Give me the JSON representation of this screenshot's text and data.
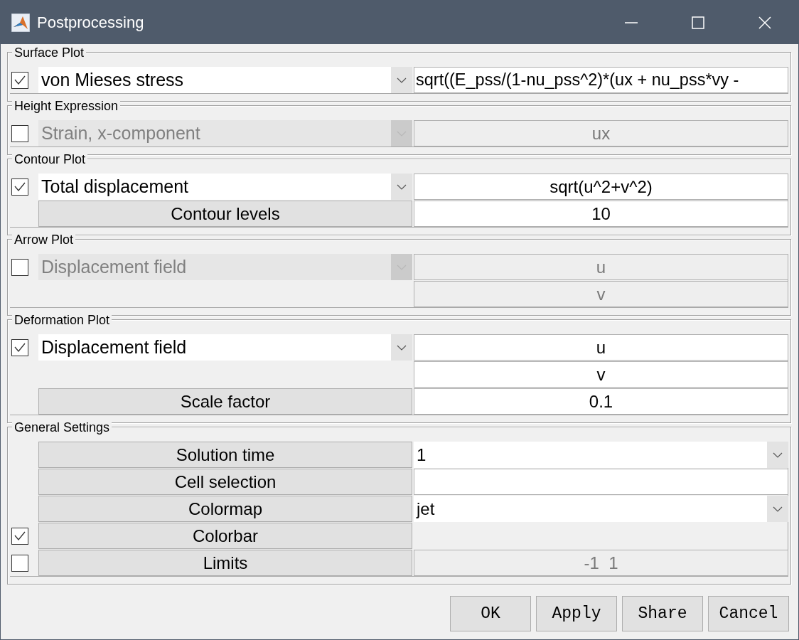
{
  "window": {
    "title": "Postprocessing"
  },
  "sections": [
    {
      "title": "Surface Plot",
      "rows": [
        {
          "checkbox": {
            "checked": true
          },
          "left": {
            "kind": "dropdown",
            "text": "von Mieses stress",
            "disabled": false
          },
          "right": {
            "kind": "long-field",
            "value": "sqrt((E_pss/(1-nu_pss^2)*(ux + nu_pss*vy -",
            "disabled": false
          }
        }
      ]
    },
    {
      "title": "Height Expression",
      "rows": [
        {
          "checkbox": {
            "checked": false
          },
          "left": {
            "kind": "dropdown",
            "text": "Strain, x-component",
            "disabled": true
          },
          "right": {
            "kind": "field",
            "value": "ux",
            "disabled": true
          }
        }
      ]
    },
    {
      "title": "Contour Plot",
      "rows": [
        {
          "checkbox": {
            "checked": true
          },
          "left": {
            "kind": "dropdown",
            "text": "Total displacement",
            "disabled": false
          },
          "right": {
            "kind": "field",
            "value": "sqrt(u^2+v^2)",
            "disabled": false
          }
        },
        {
          "left": {
            "kind": "label",
            "text": "Contour levels"
          },
          "right": {
            "kind": "field",
            "value": "10",
            "disabled": false
          }
        }
      ]
    },
    {
      "title": "Arrow Plot",
      "rows": [
        {
          "checkbox": {
            "checked": false
          },
          "left": {
            "kind": "dropdown",
            "text": "Displacement field",
            "disabled": true
          },
          "right": {
            "kind": "field",
            "value": "u",
            "disabled": true
          }
        },
        {
          "right": {
            "kind": "field",
            "value": "v",
            "disabled": true
          }
        }
      ]
    },
    {
      "title": "Deformation Plot",
      "rows": [
        {
          "checkbox": {
            "checked": true
          },
          "left": {
            "kind": "dropdown",
            "text": "Displacement field",
            "disabled": false
          },
          "right": {
            "kind": "field",
            "value": "u",
            "disabled": false
          }
        },
        {
          "right": {
            "kind": "field",
            "value": "v",
            "disabled": false
          }
        },
        {
          "left": {
            "kind": "label",
            "text": "Scale factor"
          },
          "right": {
            "kind": "field",
            "value": "0.1",
            "disabled": false
          }
        }
      ]
    },
    {
      "title": "General Settings",
      "rows": [
        {
          "left": {
            "kind": "label",
            "text": "Solution time"
          },
          "right": {
            "kind": "dropdown",
            "value": "1",
            "disabled": false
          }
        },
        {
          "left": {
            "kind": "label",
            "text": "Cell selection"
          },
          "right": {
            "kind": "empty-field",
            "disabled": false
          }
        },
        {
          "left": {
            "kind": "label",
            "text": "Colormap"
          },
          "right": {
            "kind": "dropdown",
            "value": "jet",
            "disabled": false
          }
        },
        {
          "checkbox": {
            "checked": true
          },
          "left": {
            "kind": "label",
            "text": "Colorbar"
          }
        },
        {
          "checkbox": {
            "checked": false
          },
          "left": {
            "kind": "label",
            "text": "Limits"
          },
          "right": {
            "kind": "field",
            "value": "-1  1",
            "disabled": true
          }
        }
      ]
    }
  ],
  "buttons": [
    "OK",
    "Apply",
    "Share",
    "Cancel"
  ]
}
